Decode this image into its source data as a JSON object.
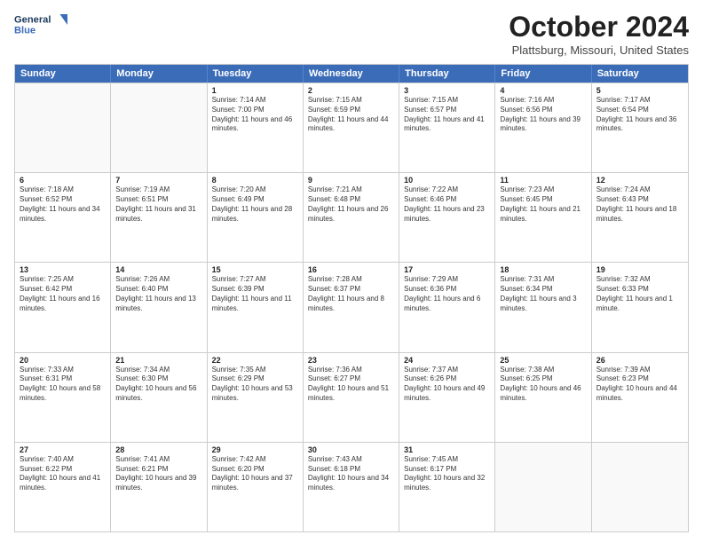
{
  "header": {
    "logo_line1": "General",
    "logo_line2": "Blue",
    "title": "October 2024",
    "location": "Plattsburg, Missouri, United States"
  },
  "days_of_week": [
    "Sunday",
    "Monday",
    "Tuesday",
    "Wednesday",
    "Thursday",
    "Friday",
    "Saturday"
  ],
  "weeks": [
    [
      {
        "day": "",
        "sunrise": "",
        "sunset": "",
        "daylight": "",
        "empty": true
      },
      {
        "day": "",
        "sunrise": "",
        "sunset": "",
        "daylight": "",
        "empty": true
      },
      {
        "day": "1",
        "sunrise": "Sunrise: 7:14 AM",
        "sunset": "Sunset: 7:00 PM",
        "daylight": "Daylight: 11 hours and 46 minutes.",
        "empty": false
      },
      {
        "day": "2",
        "sunrise": "Sunrise: 7:15 AM",
        "sunset": "Sunset: 6:59 PM",
        "daylight": "Daylight: 11 hours and 44 minutes.",
        "empty": false
      },
      {
        "day": "3",
        "sunrise": "Sunrise: 7:15 AM",
        "sunset": "Sunset: 6:57 PM",
        "daylight": "Daylight: 11 hours and 41 minutes.",
        "empty": false
      },
      {
        "day": "4",
        "sunrise": "Sunrise: 7:16 AM",
        "sunset": "Sunset: 6:56 PM",
        "daylight": "Daylight: 11 hours and 39 minutes.",
        "empty": false
      },
      {
        "day": "5",
        "sunrise": "Sunrise: 7:17 AM",
        "sunset": "Sunset: 6:54 PM",
        "daylight": "Daylight: 11 hours and 36 minutes.",
        "empty": false
      }
    ],
    [
      {
        "day": "6",
        "sunrise": "Sunrise: 7:18 AM",
        "sunset": "Sunset: 6:52 PM",
        "daylight": "Daylight: 11 hours and 34 minutes.",
        "empty": false
      },
      {
        "day": "7",
        "sunrise": "Sunrise: 7:19 AM",
        "sunset": "Sunset: 6:51 PM",
        "daylight": "Daylight: 11 hours and 31 minutes.",
        "empty": false
      },
      {
        "day": "8",
        "sunrise": "Sunrise: 7:20 AM",
        "sunset": "Sunset: 6:49 PM",
        "daylight": "Daylight: 11 hours and 28 minutes.",
        "empty": false
      },
      {
        "day": "9",
        "sunrise": "Sunrise: 7:21 AM",
        "sunset": "Sunset: 6:48 PM",
        "daylight": "Daylight: 11 hours and 26 minutes.",
        "empty": false
      },
      {
        "day": "10",
        "sunrise": "Sunrise: 7:22 AM",
        "sunset": "Sunset: 6:46 PM",
        "daylight": "Daylight: 11 hours and 23 minutes.",
        "empty": false
      },
      {
        "day": "11",
        "sunrise": "Sunrise: 7:23 AM",
        "sunset": "Sunset: 6:45 PM",
        "daylight": "Daylight: 11 hours and 21 minutes.",
        "empty": false
      },
      {
        "day": "12",
        "sunrise": "Sunrise: 7:24 AM",
        "sunset": "Sunset: 6:43 PM",
        "daylight": "Daylight: 11 hours and 18 minutes.",
        "empty": false
      }
    ],
    [
      {
        "day": "13",
        "sunrise": "Sunrise: 7:25 AM",
        "sunset": "Sunset: 6:42 PM",
        "daylight": "Daylight: 11 hours and 16 minutes.",
        "empty": false
      },
      {
        "day": "14",
        "sunrise": "Sunrise: 7:26 AM",
        "sunset": "Sunset: 6:40 PM",
        "daylight": "Daylight: 11 hours and 13 minutes.",
        "empty": false
      },
      {
        "day": "15",
        "sunrise": "Sunrise: 7:27 AM",
        "sunset": "Sunset: 6:39 PM",
        "daylight": "Daylight: 11 hours and 11 minutes.",
        "empty": false
      },
      {
        "day": "16",
        "sunrise": "Sunrise: 7:28 AM",
        "sunset": "Sunset: 6:37 PM",
        "daylight": "Daylight: 11 hours and 8 minutes.",
        "empty": false
      },
      {
        "day": "17",
        "sunrise": "Sunrise: 7:29 AM",
        "sunset": "Sunset: 6:36 PM",
        "daylight": "Daylight: 11 hours and 6 minutes.",
        "empty": false
      },
      {
        "day": "18",
        "sunrise": "Sunrise: 7:31 AM",
        "sunset": "Sunset: 6:34 PM",
        "daylight": "Daylight: 11 hours and 3 minutes.",
        "empty": false
      },
      {
        "day": "19",
        "sunrise": "Sunrise: 7:32 AM",
        "sunset": "Sunset: 6:33 PM",
        "daylight": "Daylight: 11 hours and 1 minute.",
        "empty": false
      }
    ],
    [
      {
        "day": "20",
        "sunrise": "Sunrise: 7:33 AM",
        "sunset": "Sunset: 6:31 PM",
        "daylight": "Daylight: 10 hours and 58 minutes.",
        "empty": false
      },
      {
        "day": "21",
        "sunrise": "Sunrise: 7:34 AM",
        "sunset": "Sunset: 6:30 PM",
        "daylight": "Daylight: 10 hours and 56 minutes.",
        "empty": false
      },
      {
        "day": "22",
        "sunrise": "Sunrise: 7:35 AM",
        "sunset": "Sunset: 6:29 PM",
        "daylight": "Daylight: 10 hours and 53 minutes.",
        "empty": false
      },
      {
        "day": "23",
        "sunrise": "Sunrise: 7:36 AM",
        "sunset": "Sunset: 6:27 PM",
        "daylight": "Daylight: 10 hours and 51 minutes.",
        "empty": false
      },
      {
        "day": "24",
        "sunrise": "Sunrise: 7:37 AM",
        "sunset": "Sunset: 6:26 PM",
        "daylight": "Daylight: 10 hours and 49 minutes.",
        "empty": false
      },
      {
        "day": "25",
        "sunrise": "Sunrise: 7:38 AM",
        "sunset": "Sunset: 6:25 PM",
        "daylight": "Daylight: 10 hours and 46 minutes.",
        "empty": false
      },
      {
        "day": "26",
        "sunrise": "Sunrise: 7:39 AM",
        "sunset": "Sunset: 6:23 PM",
        "daylight": "Daylight: 10 hours and 44 minutes.",
        "empty": false
      }
    ],
    [
      {
        "day": "27",
        "sunrise": "Sunrise: 7:40 AM",
        "sunset": "Sunset: 6:22 PM",
        "daylight": "Daylight: 10 hours and 41 minutes.",
        "empty": false
      },
      {
        "day": "28",
        "sunrise": "Sunrise: 7:41 AM",
        "sunset": "Sunset: 6:21 PM",
        "daylight": "Daylight: 10 hours and 39 minutes.",
        "empty": false
      },
      {
        "day": "29",
        "sunrise": "Sunrise: 7:42 AM",
        "sunset": "Sunset: 6:20 PM",
        "daylight": "Daylight: 10 hours and 37 minutes.",
        "empty": false
      },
      {
        "day": "30",
        "sunrise": "Sunrise: 7:43 AM",
        "sunset": "Sunset: 6:18 PM",
        "daylight": "Daylight: 10 hours and 34 minutes.",
        "empty": false
      },
      {
        "day": "31",
        "sunrise": "Sunrise: 7:45 AM",
        "sunset": "Sunset: 6:17 PM",
        "daylight": "Daylight: 10 hours and 32 minutes.",
        "empty": false
      },
      {
        "day": "",
        "sunrise": "",
        "sunset": "",
        "daylight": "",
        "empty": true
      },
      {
        "day": "",
        "sunrise": "",
        "sunset": "",
        "daylight": "",
        "empty": true
      }
    ]
  ]
}
